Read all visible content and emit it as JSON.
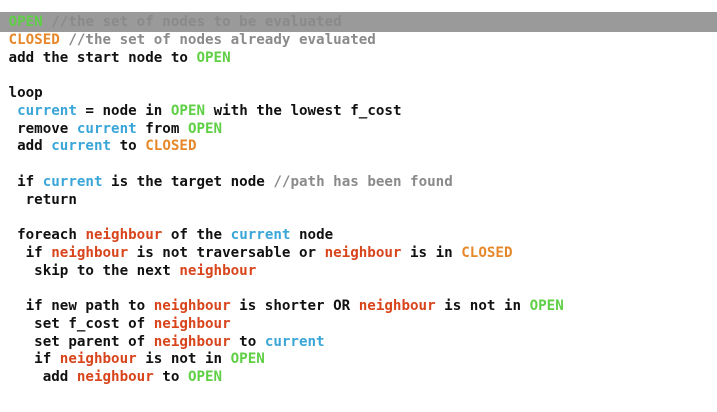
{
  "colors": {
    "background": "#ffffff",
    "header_bar": "#9a9a9a",
    "plain_text": "#111111",
    "comment": "#8a8a8a",
    "open": "#5fcf45",
    "closed": "#e6882a",
    "current": "#3aa6d8",
    "neighbour": "#d8451c"
  },
  "code_lines": [
    {
      "indent": 0,
      "tokens": [
        {
          "t": "OPEN",
          "c": "open"
        },
        {
          "t": " //the set of nodes to be evaluated",
          "c": "comment"
        }
      ]
    },
    {
      "indent": 0,
      "tokens": [
        {
          "t": "CLOSED",
          "c": "closed"
        },
        {
          "t": " //the set of nodes already evaluated",
          "c": "comment"
        }
      ]
    },
    {
      "indent": 0,
      "tokens": [
        {
          "t": "add the start node to "
        },
        {
          "t": "OPEN",
          "c": "open"
        }
      ]
    },
    {
      "indent": 0,
      "tokens": []
    },
    {
      "indent": 0,
      "tokens": [
        {
          "t": "loop"
        }
      ]
    },
    {
      "indent": 1,
      "tokens": [
        {
          "t": "current",
          "c": "current"
        },
        {
          "t": " = node in "
        },
        {
          "t": "OPEN",
          "c": "open"
        },
        {
          "t": " with the lowest f_cost"
        }
      ]
    },
    {
      "indent": 1,
      "tokens": [
        {
          "t": "remove "
        },
        {
          "t": "current",
          "c": "current"
        },
        {
          "t": " from "
        },
        {
          "t": "OPEN",
          "c": "open"
        }
      ]
    },
    {
      "indent": 1,
      "tokens": [
        {
          "t": "add "
        },
        {
          "t": "current",
          "c": "current"
        },
        {
          "t": " to "
        },
        {
          "t": "CLOSED",
          "c": "closed"
        }
      ]
    },
    {
      "indent": 0,
      "tokens": []
    },
    {
      "indent": 1,
      "tokens": [
        {
          "t": "if "
        },
        {
          "t": "current",
          "c": "current"
        },
        {
          "t": " is the target node "
        },
        {
          "t": "//path has been found",
          "c": "comment"
        }
      ]
    },
    {
      "indent": 2,
      "tokens": [
        {
          "t": "return"
        }
      ]
    },
    {
      "indent": 0,
      "tokens": []
    },
    {
      "indent": 1,
      "tokens": [
        {
          "t": "foreach "
        },
        {
          "t": "neighbour",
          "c": "neighbour"
        },
        {
          "t": " of the "
        },
        {
          "t": "current",
          "c": "current"
        },
        {
          "t": " node"
        }
      ]
    },
    {
      "indent": 2,
      "tokens": [
        {
          "t": "if "
        },
        {
          "t": "neighbour",
          "c": "neighbour"
        },
        {
          "t": " is not traversable or "
        },
        {
          "t": "neighbour",
          "c": "neighbour"
        },
        {
          "t": " is in "
        },
        {
          "t": "CLOSED",
          "c": "closed"
        }
      ]
    },
    {
      "indent": 3,
      "tokens": [
        {
          "t": "skip to the next "
        },
        {
          "t": "neighbour",
          "c": "neighbour"
        }
      ]
    },
    {
      "indent": 0,
      "tokens": []
    },
    {
      "indent": 2,
      "tokens": [
        {
          "t": "if new path to "
        },
        {
          "t": "neighbour",
          "c": "neighbour"
        },
        {
          "t": " is shorter OR "
        },
        {
          "t": "neighbour",
          "c": "neighbour"
        },
        {
          "t": " is not in "
        },
        {
          "t": "OPEN",
          "c": "open"
        }
      ]
    },
    {
      "indent": 3,
      "tokens": [
        {
          "t": "set f_cost of "
        },
        {
          "t": "neighbour",
          "c": "neighbour"
        }
      ]
    },
    {
      "indent": 3,
      "tokens": [
        {
          "t": "set parent of "
        },
        {
          "t": "neighbour",
          "c": "neighbour"
        },
        {
          "t": " to "
        },
        {
          "t": "current",
          "c": "current"
        }
      ]
    },
    {
      "indent": 3,
      "tokens": [
        {
          "t": "if "
        },
        {
          "t": "neighbour",
          "c": "neighbour"
        },
        {
          "t": " is not in "
        },
        {
          "t": "OPEN",
          "c": "open"
        }
      ]
    },
    {
      "indent": 4,
      "tokens": [
        {
          "t": "add "
        },
        {
          "t": "neighbour",
          "c": "neighbour"
        },
        {
          "t": " to "
        },
        {
          "t": "OPEN",
          "c": "open"
        }
      ]
    }
  ]
}
